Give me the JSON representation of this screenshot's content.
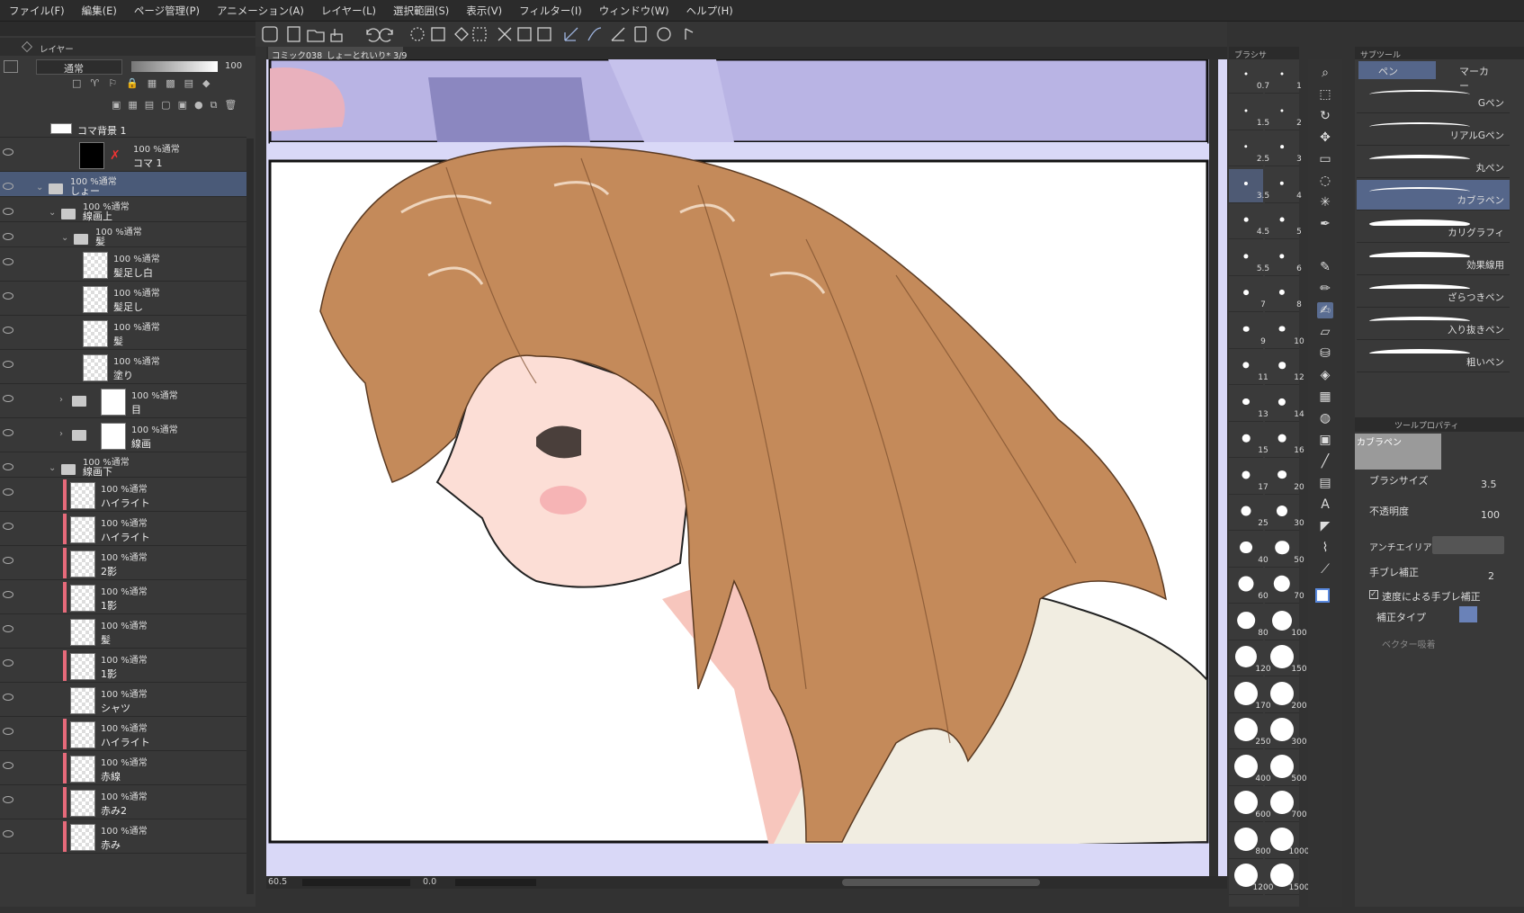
{
  "menu": [
    "ファイル(F)",
    "編集(E)",
    "ページ管理(P)",
    "アニメーション(A)",
    "レイヤー(L)",
    "選択範囲(S)",
    "表示(V)",
    "フィルター(I)",
    "ウィンドウ(W)",
    "ヘルプ(H)"
  ],
  "layer_panel": {
    "tab": "レイヤー",
    "blend_mode": "通常",
    "opacity": "100",
    "layers": [
      {
        "mode": "",
        "name": "コマ背景 1",
        "indent": 0,
        "kind": "white"
      },
      {
        "mode": "100 %通常",
        "name": "コマ 1",
        "indent": 1,
        "kind": "koma"
      },
      {
        "mode": "100 %通常",
        "name": "しょー",
        "indent": 1,
        "kind": "folder",
        "selected": true
      },
      {
        "mode": "100 %通常",
        "name": "線画上",
        "indent": 2,
        "kind": "folder"
      },
      {
        "mode": "100 %通常",
        "name": "髪",
        "indent": 3,
        "kind": "folder"
      },
      {
        "mode": "100 %通常",
        "name": "髪足し白",
        "indent": 4,
        "kind": "raster"
      },
      {
        "mode": "100 %通常",
        "name": "髪足し",
        "indent": 4,
        "kind": "raster"
      },
      {
        "mode": "100 %通常",
        "name": "髪",
        "indent": 4,
        "kind": "raster"
      },
      {
        "mode": "100 %通常",
        "name": "塗り",
        "indent": 4,
        "kind": "raster"
      },
      {
        "mode": "100 %通常",
        "name": "目",
        "indent": 3,
        "kind": "folderthumb"
      },
      {
        "mode": "100 %通常",
        "name": "線画",
        "indent": 3,
        "kind": "folderthumb"
      },
      {
        "mode": "100 %通常",
        "name": "線画下",
        "indent": 2,
        "kind": "folder"
      },
      {
        "mode": "100 %通常",
        "name": "ハイライト",
        "indent": 3,
        "kind": "clip"
      },
      {
        "mode": "100 %通常",
        "name": "ハイライト",
        "indent": 3,
        "kind": "clip"
      },
      {
        "mode": "100 %通常",
        "name": "2影",
        "indent": 3,
        "kind": "clip"
      },
      {
        "mode": "100 %通常",
        "name": "1影",
        "indent": 3,
        "kind": "clip"
      },
      {
        "mode": "100 %通常",
        "name": "髪",
        "indent": 3,
        "kind": "raster"
      },
      {
        "mode": "100 %通常",
        "name": "1影",
        "indent": 3,
        "kind": "clip"
      },
      {
        "mode": "100 %通常",
        "name": "シャツ",
        "indent": 3,
        "kind": "raster"
      },
      {
        "mode": "100 %通常",
        "name": "ハイライト",
        "indent": 3,
        "kind": "clip"
      },
      {
        "mode": "100 %通常",
        "name": "赤線",
        "indent": 3,
        "kind": "clip"
      },
      {
        "mode": "100 %通常",
        "name": "赤み2",
        "indent": 3,
        "kind": "clip"
      },
      {
        "mode": "100 %通常",
        "name": "赤み",
        "indent": 3,
        "kind": "clip"
      }
    ]
  },
  "canvas": {
    "tab_title": "コミック038_しょーとれいり* 3/9",
    "zoom": "60.5",
    "rotation": "0.0"
  },
  "brush_size": {
    "tab": "ブラシサ",
    "sizes": [
      "0.7",
      "1",
      "1.5",
      "2",
      "2.5",
      "3",
      "3.5",
      "4",
      "4.5",
      "5",
      "5.5",
      "6",
      "7",
      "8",
      "9",
      "10",
      "11",
      "12",
      "13",
      "14",
      "15",
      "16",
      "17",
      "20",
      "25",
      "30",
      "40",
      "50",
      "60",
      "70",
      "80",
      "100",
      "120",
      "150",
      "170",
      "200",
      "250",
      "300",
      "400",
      "500",
      "600",
      "700",
      "800",
      "1000",
      "1200",
      "1500"
    ],
    "selected": "3.5"
  },
  "sub_tool": {
    "tab": "サブツール",
    "groups": [
      "ペン",
      "マーカー"
    ],
    "brushes": [
      "Gペン",
      "リアルGペン",
      "丸ペン",
      "カブラペン",
      "カリグラフィ",
      "効果線用",
      "ざらつきペン",
      "入り抜きペン",
      "粗いペン"
    ],
    "selected": "カブラペン"
  },
  "tool_property": {
    "tab": "ツールプロパティ",
    "tool_name": "カブラペン",
    "brush_size_label": "ブラシサイズ",
    "brush_size_value": "3.5",
    "opacity_label": "不透明度",
    "opacity_value": "100",
    "antialias_label": "アンチエイリアス",
    "stabilization_label": "手ブレ補正",
    "stabilization_value": "2",
    "speed_stabilization_label": "速度による手ブレ補正",
    "correction_type_label": "補正タイプ",
    "vector_snap_label": "ベクター吸着"
  }
}
